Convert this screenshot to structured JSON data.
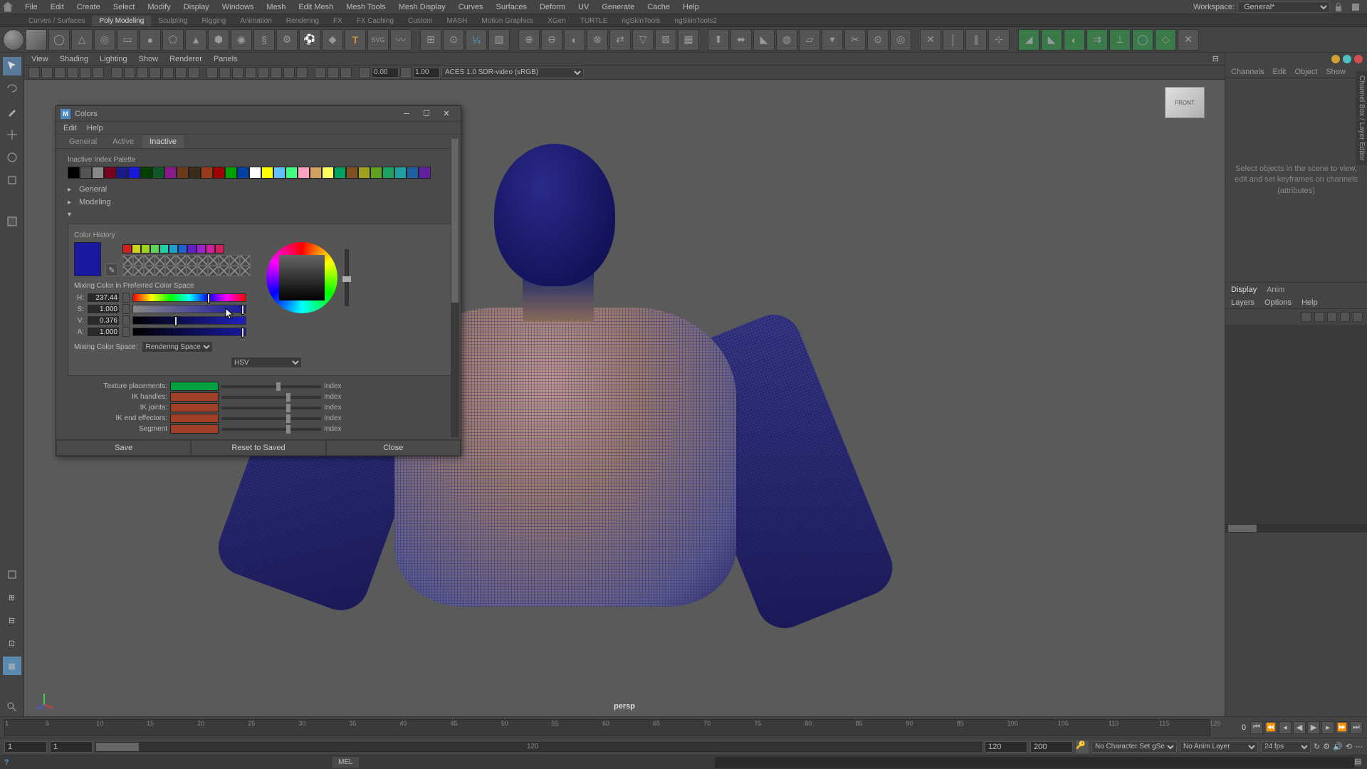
{
  "menubar": {
    "items": [
      "File",
      "Edit",
      "Create",
      "Select",
      "Modify",
      "Display",
      "Windows",
      "Mesh",
      "Edit Mesh",
      "Mesh Tools",
      "Mesh Display",
      "Curves",
      "Surfaces",
      "Deform",
      "UV",
      "Generate",
      "Cache",
      "Help"
    ],
    "workspace_label": "Workspace:",
    "workspace_value": "General*"
  },
  "shelf_tabs": [
    "Curves / Surfaces",
    "Poly Modeling",
    "Sculpting",
    "Rigging",
    "Animation",
    "Rendering",
    "FX",
    "FX Caching",
    "Custom",
    "MASH",
    "Motion Graphics",
    "XGen",
    "TURTLE",
    "ngSkinTools",
    "ngSkinTools2"
  ],
  "shelf_active_tab": 1,
  "viewport_menu": [
    "View",
    "Shading",
    "Lighting",
    "Show",
    "Renderer",
    "Panels"
  ],
  "vp_toolbar": {
    "num1": "0.00",
    "num2": "1.00",
    "colorspace": "ACES 1.0 SDR-video (sRGB)"
  },
  "viewport": {
    "camera_label": "persp",
    "viewcube_face": "FRONT"
  },
  "channelbox": {
    "corner_colors": [
      "#d0a030",
      "#50c0c0",
      "#d05050"
    ],
    "top_tabs": [
      "Channels",
      "Edit",
      "Object",
      "Show"
    ],
    "message": "Select objects in the scene to view, edit and set keyframes on channels (attributes)",
    "vert_tab": "Channel Box / Layer Editor",
    "layer_tabs": [
      "Display",
      "Anim"
    ],
    "layer_menu": [
      "Layers",
      "Options",
      "Help"
    ]
  },
  "timeline": {
    "ticks": [
      1,
      5,
      10,
      15,
      20,
      25,
      30,
      35,
      40,
      45,
      50,
      55,
      60,
      65,
      70,
      75,
      80,
      85,
      90,
      95,
      100,
      105,
      110,
      115,
      120
    ],
    "current_frame": "0",
    "range_start": "1",
    "range_inner_start": "1",
    "range_label": "120",
    "range_inner_end": "120",
    "range_end": "200",
    "char_set": "No Character Set gSet",
    "anim_layer": "No Anim Layer",
    "fps": "24 fps"
  },
  "cmdline": {
    "lang": "MEL"
  },
  "dialog": {
    "title": "Colors",
    "menu": [
      "Edit",
      "Help"
    ],
    "tabs": [
      "General",
      "Active",
      "Inactive"
    ],
    "active_tab": 2,
    "palette_label": "Inactive Index Palette",
    "palette": [
      "#000000",
      "#555555",
      "#888888",
      "#7a0020",
      "#1a1a8a",
      "#1818d8",
      "#004000",
      "#105828",
      "#8a1a8a",
      "#6a3a1a",
      "#3a2a1a",
      "#9a3a1a",
      "#a00000",
      "#00a000",
      "#0040a0",
      "#ffffff",
      "#ffff00",
      "#60c0ff",
      "#40ff80",
      "#ffa0c0",
      "#d0a060",
      "#ffff60",
      "#00a060",
      "#805020",
      "#a0a020",
      "#60a020",
      "#20a060",
      "#20a0a0",
      "#2060a0",
      "#6020a0"
    ],
    "tree": [
      {
        "label": "General",
        "expanded": false
      },
      {
        "label": "Modeling",
        "expanded": false
      }
    ],
    "color_history_label": "Color History",
    "current_color": "#1818a0",
    "history_colors": [
      "#d02020",
      "#d0d020",
      "#a0d020",
      "#60d060",
      "#20d0a0",
      "#20a0d0",
      "#2060d0",
      "#6020d0",
      "#a020d0",
      "#d020a0",
      "#d02060"
    ],
    "mixing_label": "Mixing Color in Preferred Color Space",
    "hsv": {
      "h": "237.44",
      "s": "1.000",
      "v": "0.376",
      "a": "1.000"
    },
    "color_model": "HSV",
    "mixing_space_label": "Mixing Color Space:",
    "mixing_space": "Rendering Space",
    "index_rows": [
      {
        "label": "Texture placements:",
        "color": "#00a040",
        "value": "Index",
        "pos": 55
      },
      {
        "label": "IK handles:",
        "color": "#a04028",
        "value": "Index",
        "pos": 65
      },
      {
        "label": "IK joints:",
        "color": "#a04028",
        "value": "Index",
        "pos": 65
      },
      {
        "label": "IK end effectors:",
        "color": "#a04028",
        "value": "Index",
        "pos": 65
      },
      {
        "label": "Segment",
        "color": "#a04028",
        "value": "Index",
        "pos": 65
      }
    ],
    "buttons": {
      "save": "Save",
      "reset": "Reset to Saved",
      "close": "Close"
    }
  }
}
